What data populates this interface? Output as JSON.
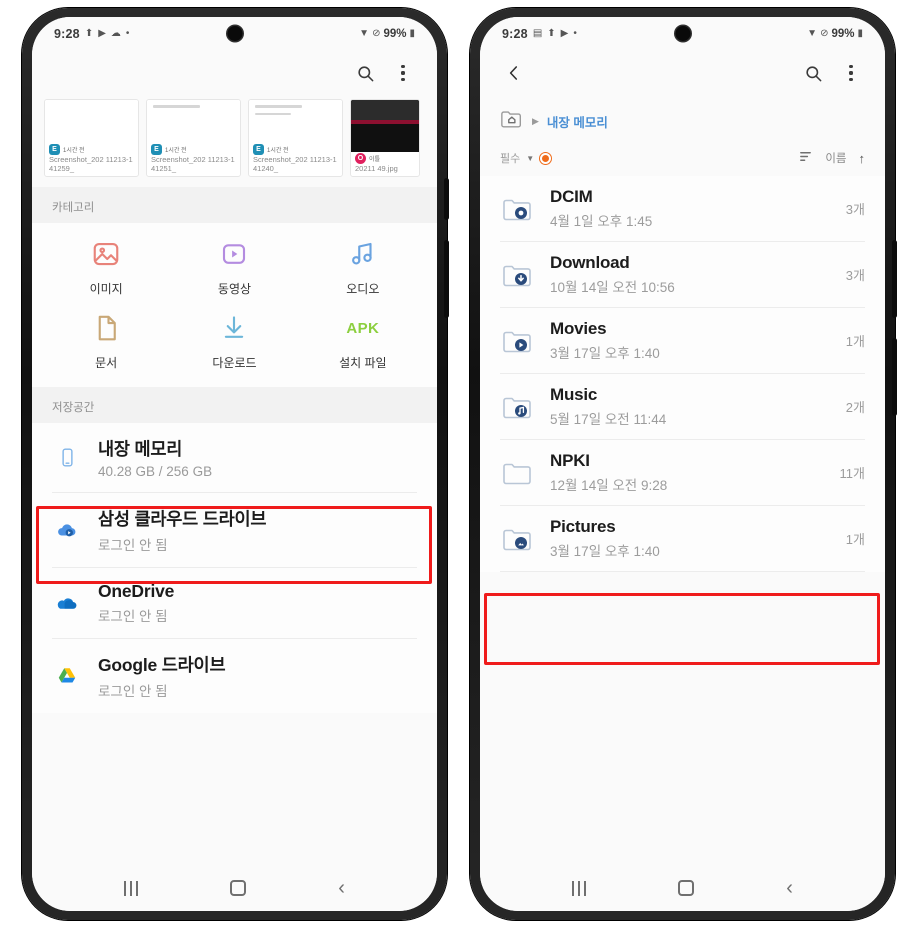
{
  "left_phone": {
    "status_bar": {
      "time": "9:28",
      "icons": [
        "location-icon",
        "cast-icon",
        "cloud-icon",
        "dot-icon"
      ],
      "right_icons": [
        "wifi-icon",
        "mute-icon"
      ],
      "battery": "99%"
    },
    "app_bar": {
      "search": "search-icon",
      "more": "more-options-icon"
    },
    "recent_files": [
      {
        "app_badge": "E",
        "app_name": "1시간 전",
        "filename": "Screenshot_202 11213-141259_"
      },
      {
        "app_badge": "E",
        "app_name": "1시간 전",
        "filename": "Screenshot_202 11213-141251_"
      },
      {
        "app_badge": "E",
        "app_name": "1시간 전",
        "filename": "Screenshot_202 11213-141240_"
      },
      {
        "app_badge": "O",
        "app_name": "이틀",
        "filename": "20211 49.jpg"
      }
    ],
    "categories_header": "카테고리",
    "categories": [
      {
        "label": "이미지",
        "icon": "image-icon",
        "color": "#e8837a"
      },
      {
        "label": "동영상",
        "icon": "video-icon",
        "color": "#b48ce0"
      },
      {
        "label": "오디오",
        "icon": "audio-icon",
        "color": "#6aa3e0"
      },
      {
        "label": "문서",
        "icon": "document-icon",
        "color": "#c9a877"
      },
      {
        "label": "다운로드",
        "icon": "download-icon",
        "color": "#6cb6d9"
      },
      {
        "label": "설치 파일",
        "icon": "apk-icon",
        "color": "#8ccf3f",
        "text": "APK"
      }
    ],
    "storage_header": "저장공간",
    "storage": [
      {
        "title": "내장 메모리",
        "sub": "40.28 GB / 256 GB",
        "icon": "phone-storage-icon",
        "highlighted": true
      },
      {
        "title": "삼성 클라우드 드라이브",
        "sub": "로그인 안 됨",
        "icon": "samsung-cloud-icon",
        "highlighted": false
      },
      {
        "title": "OneDrive",
        "sub": "로그인 안 됨",
        "icon": "onedrive-icon",
        "highlighted": false
      },
      {
        "title": "Google 드라이브",
        "sub": "로그인 안 됨",
        "icon": "google-drive-icon",
        "highlighted": false
      }
    ],
    "nav_bar": {
      "recents": "recents-icon",
      "home": "home-icon",
      "back": "back-icon"
    }
  },
  "right_phone": {
    "status_bar": {
      "time": "9:28",
      "icons": [
        "image-icon",
        "location-icon",
        "cast-icon",
        "dot-icon"
      ],
      "right_icons": [
        "wifi-icon",
        "mute-icon"
      ],
      "battery": "99%"
    },
    "app_bar": {
      "back": "back-icon",
      "search": "search-icon",
      "more": "more-options-icon"
    },
    "breadcrumb": {
      "home_icon": "home-folder-icon",
      "separator": "▶",
      "current": "내장 메모리"
    },
    "filter_bar": {
      "filter_label": "필수",
      "caret": "caret-down-icon",
      "badge": "filter-active-badge",
      "sort_icon": "sort-icon",
      "sort_label": "이름",
      "sort_direction": "↑"
    },
    "files": [
      {
        "name": "DCIM",
        "date": "4월 1일 오후 1:45",
        "count": "3개",
        "icon": "folder-camera-icon",
        "highlighted": false
      },
      {
        "name": "Download",
        "date": "10월 14일 오전 10:56",
        "count": "3개",
        "icon": "folder-download-icon",
        "highlighted": false
      },
      {
        "name": "Movies",
        "date": "3월 17일 오후 1:40",
        "count": "1개",
        "icon": "folder-movies-icon",
        "highlighted": false
      },
      {
        "name": "Music",
        "date": "5월 17일 오전 11:44",
        "count": "2개",
        "icon": "folder-music-icon",
        "highlighted": false
      },
      {
        "name": "NPKI",
        "date": "12월 14일 오전 9:28",
        "count": "11개",
        "icon": "folder-icon",
        "highlighted": true
      },
      {
        "name": "Pictures",
        "date": "3월 17일 오후 1:40",
        "count": "1개",
        "icon": "folder-pictures-icon",
        "highlighted": false
      }
    ],
    "nav_bar": {
      "recents": "recents-icon",
      "home": "home-icon",
      "back": "back-icon"
    }
  },
  "colors": {
    "highlight": "#ef1b1b",
    "link": "#4a8fd4",
    "accent_orange": "#ef6c1b"
  }
}
